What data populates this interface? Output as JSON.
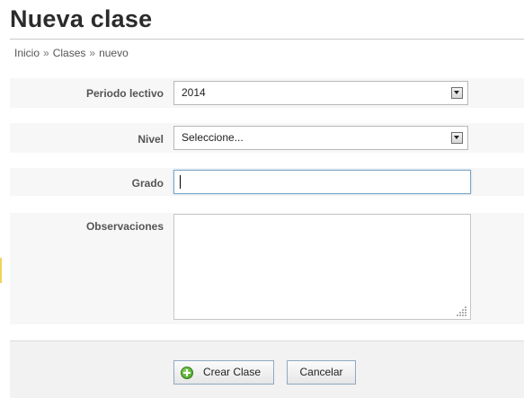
{
  "page": {
    "title": "Nueva clase"
  },
  "breadcrumb": {
    "items": [
      "Inicio",
      "Clases",
      "nuevo"
    ],
    "separator": "»"
  },
  "form": {
    "periodo": {
      "label": "Periodo lectivo",
      "selected": "2014"
    },
    "nivel": {
      "label": "Nivel",
      "selected": "Seleccione..."
    },
    "grado": {
      "label": "Grado",
      "value": ""
    },
    "observaciones": {
      "label": "Observaciones",
      "value": ""
    }
  },
  "actions": {
    "create_label": "Crear Clase",
    "cancel_label": "Cancelar"
  },
  "icons": {
    "create": "plus-circle-icon",
    "dropdown": "chevron-down-icon",
    "resize": "resize-grip-icon"
  },
  "colors": {
    "focus_border": "#7aa7c7",
    "row_background": "#f7f7f7",
    "footer_background": "#f2f2f2",
    "create_icon": "#3e9a1d"
  }
}
